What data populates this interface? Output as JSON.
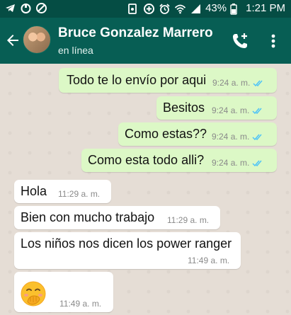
{
  "status_bar": {
    "battery": "43%",
    "time": "1:21 PM"
  },
  "header": {
    "contact_name": "Bruce Gonzalez Marrero",
    "contact_status": "en línea"
  },
  "messages": [
    {
      "text": "Todo te lo envío por aqui",
      "time": "9:24 a. m."
    },
    {
      "text": "Besitos",
      "time": "9:24 a. m."
    },
    {
      "text": "Como estas??",
      "time": "9:24 a. m."
    },
    {
      "text": "Como esta todo alli?",
      "time": "9:24 a. m."
    },
    {
      "text": "Hola",
      "time": "11:29 a. m."
    },
    {
      "text": "Bien con mucho trabajo",
      "time": "11:29 a. m."
    },
    {
      "text": "Los niños nos dicen los power ranger",
      "time": "11:49 a. m."
    },
    {
      "emoji": "face-with-hand-over-mouth",
      "time": "11:49 a. m."
    }
  ],
  "colors": {
    "status_bar_bg": "#054d44",
    "header_bg": "#075e54",
    "outgoing_bubble": "#dcf8c6",
    "incoming_bubble": "#ffffff",
    "read_ticks": "#4fc3f7",
    "chat_bg": "#e5ddd5"
  }
}
